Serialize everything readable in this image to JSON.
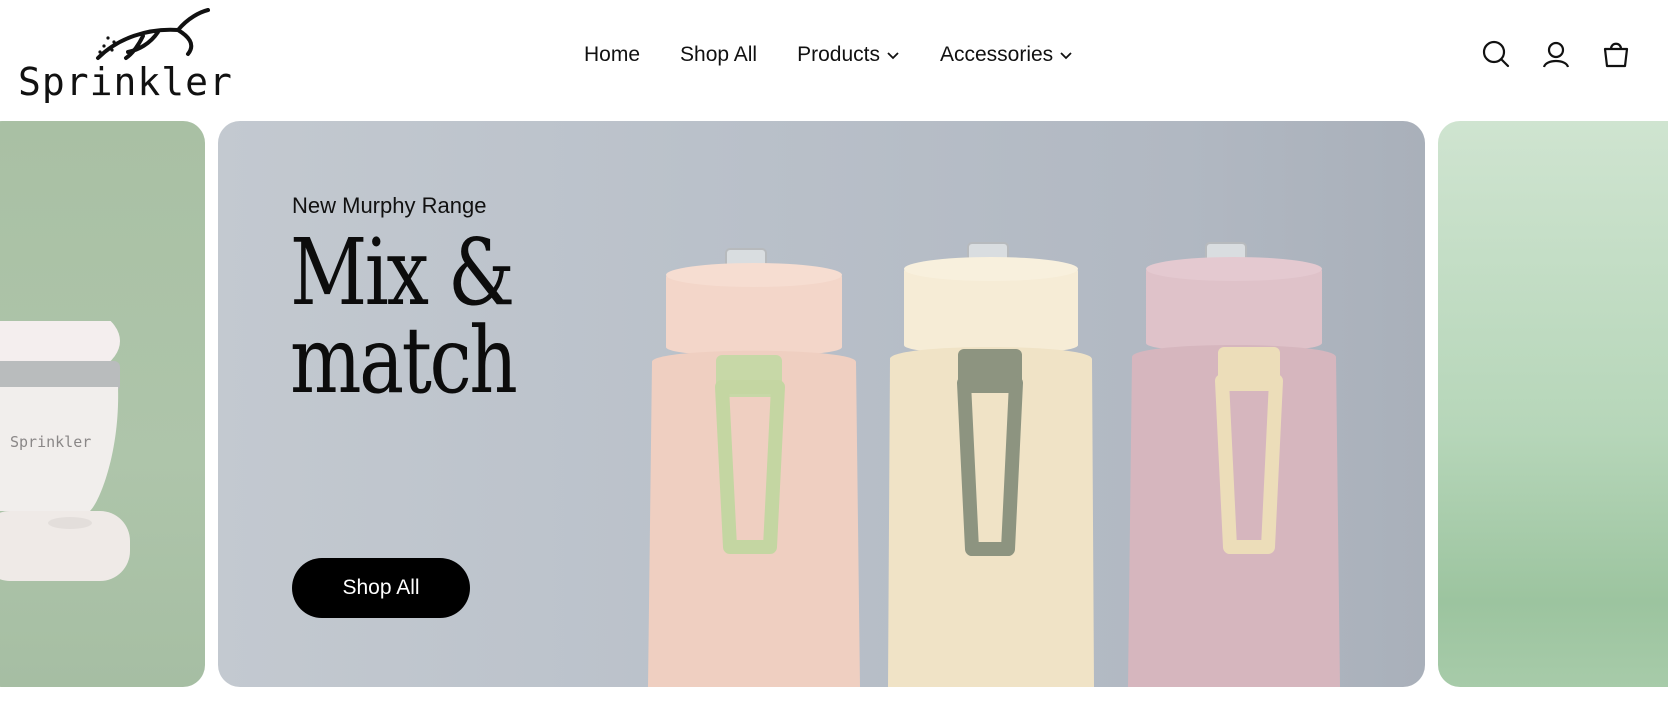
{
  "brand": {
    "name": "Sprinkler"
  },
  "nav": {
    "items": [
      {
        "label": "Home",
        "has_dropdown": false
      },
      {
        "label": "Shop All",
        "has_dropdown": false
      },
      {
        "label": "Products",
        "has_dropdown": true
      },
      {
        "label": "Accessories",
        "has_dropdown": true
      }
    ]
  },
  "header_icons": [
    "search-icon",
    "account-icon",
    "cart-icon"
  ],
  "hero": {
    "eyebrow": "New Murphy Range",
    "headline_line1": "Mix &",
    "headline_line2": "match",
    "cta_label": "Shop All"
  },
  "left_slide": {
    "product_brand": "Sprinkler"
  },
  "colors": {
    "bottle_pink": "#f0d3c6",
    "bottle_cream": "#f1e5c9",
    "bottle_mauve": "#d8b8c0",
    "strap_green": "#c9d9a9",
    "strap_olive": "#8f9682",
    "strap_beige": "#ebdcb8",
    "cta_bg": "#000000"
  }
}
